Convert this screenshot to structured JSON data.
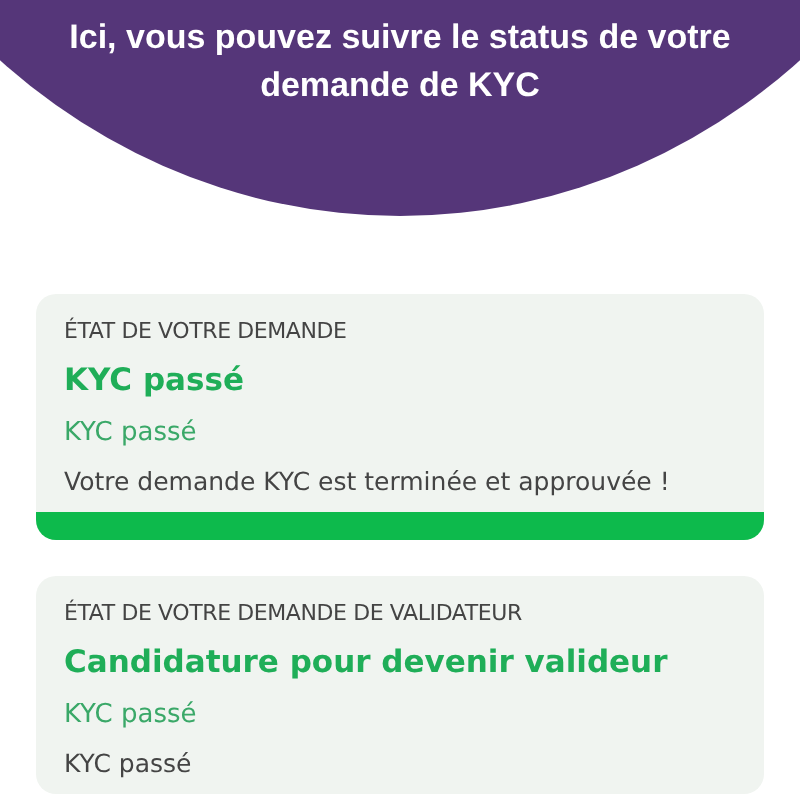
{
  "header": {
    "title": "Ici, vous pouvez suivre le status de votre demande de KYC"
  },
  "cards": [
    {
      "label": "ÉTAT DE VOTRE DEMANDE",
      "heading": "KYC passé",
      "status": "KYC passé",
      "message": "Votre demande KYC est terminée et approuvée !",
      "progress": {
        "level": 1
      }
    },
    {
      "label": "ÉTAT DE VOTRE DEMANDE DE VALIDATEUR",
      "heading": "Candidature pour devenir valideur",
      "status": "KYC passé",
      "message": "KYC passé"
    }
  ]
}
